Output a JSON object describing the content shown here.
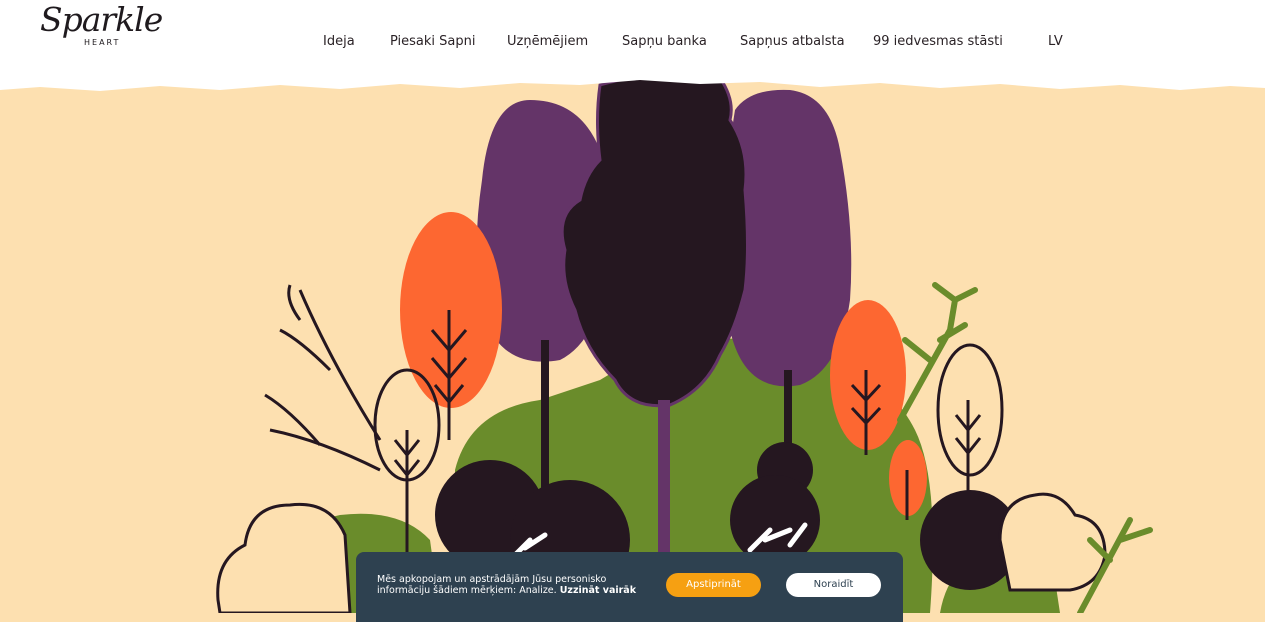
{
  "brand": {
    "logo_script": "Sparkle",
    "logo_sub": "HEART"
  },
  "nav": {
    "items": [
      {
        "label": "Ideja"
      },
      {
        "label": "Piesaki Sapni"
      },
      {
        "label": "Uzņēmējiem"
      },
      {
        "label": "Sapņu banka"
      },
      {
        "label": "Sapņus atbalsta"
      },
      {
        "label": "99 iedvesmas stāsti"
      }
    ],
    "language": "LV"
  },
  "cookie": {
    "message": "Mēs apkopojam un apstrādājām Jūsu personisko informāciju šādiem mērķiem: Analize.",
    "learn_more": "Uzzināt vairāk",
    "accept_label": "Apstiprināt",
    "reject_label": "Noraidīt"
  },
  "colors": {
    "background": "#fde0b0",
    "purple": "#643468",
    "dark": "#251720",
    "orange": "#fd6731",
    "green": "#6a8c2b",
    "cookie_bg": "#2e4150",
    "accept": "#f6a012"
  }
}
